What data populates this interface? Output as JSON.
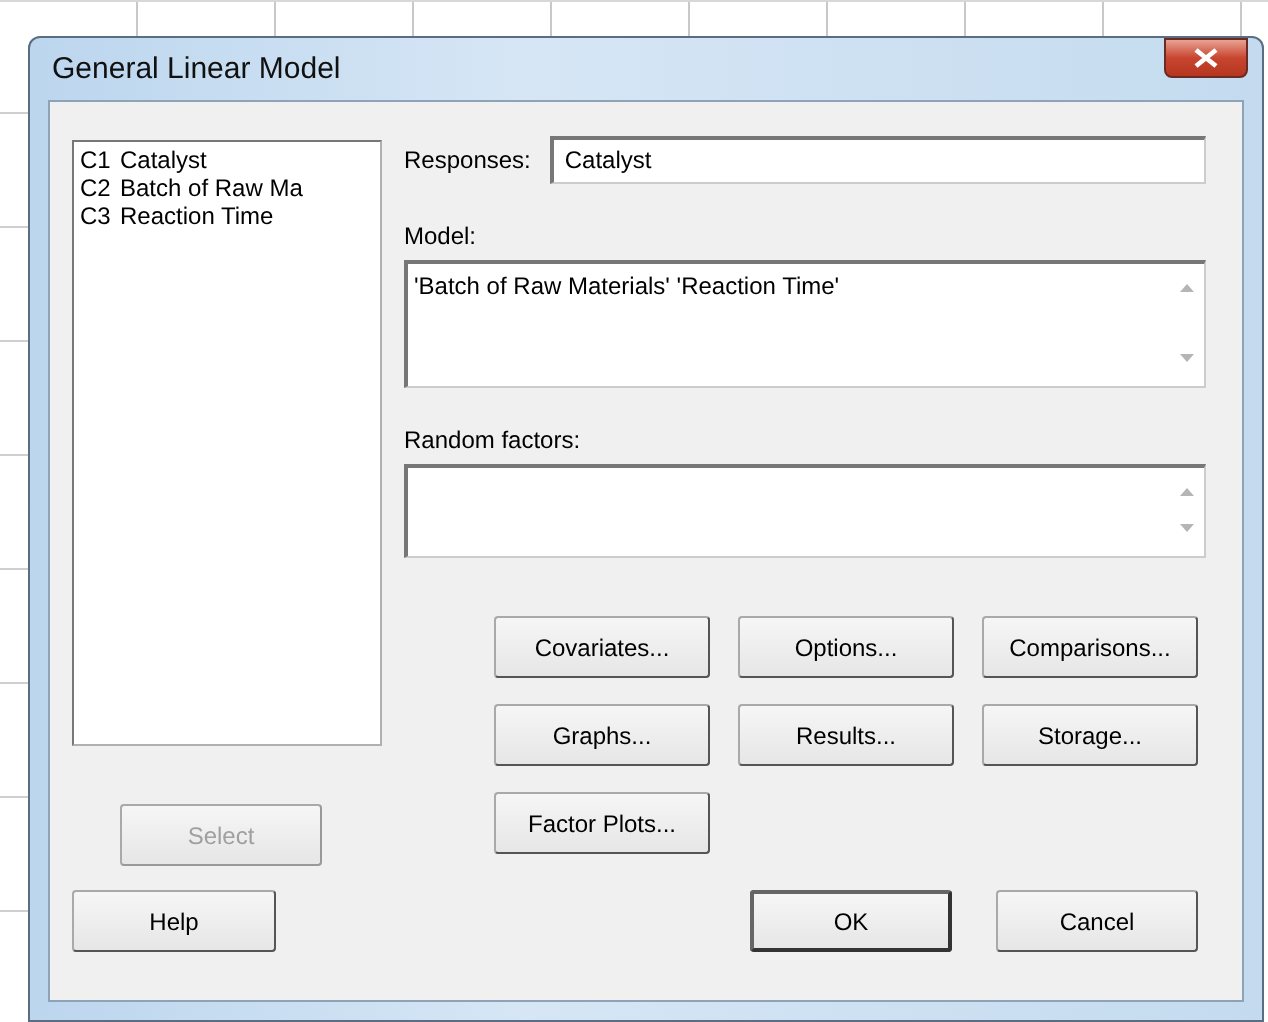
{
  "window": {
    "title": "General Linear Model"
  },
  "variables": [
    {
      "column": "C1",
      "name": "Catalyst"
    },
    {
      "column": "C2",
      "name": "Batch of Raw Ma"
    },
    {
      "column": "C3",
      "name": "Reaction Time"
    }
  ],
  "responses": {
    "label": "Responses:",
    "value": "Catalyst"
  },
  "model": {
    "label": "Model:",
    "value": "'Batch of Raw Materials' 'Reaction Time'"
  },
  "random_factors": {
    "label": "Random factors:"
  },
  "option_buttons": [
    {
      "label": "Covariates..."
    },
    {
      "label": "Options..."
    },
    {
      "label": "Comparisons..."
    },
    {
      "label": "Graphs..."
    },
    {
      "label": "Results..."
    },
    {
      "label": "Storage..."
    },
    {
      "label": "Factor Plots..."
    }
  ],
  "select_button": {
    "label": "Select",
    "disabled": true
  },
  "help_button": {
    "label": "Help"
  },
  "action_buttons": [
    {
      "label": "OK",
      "default": true
    },
    {
      "label": "Cancel",
      "default": false
    }
  ]
}
